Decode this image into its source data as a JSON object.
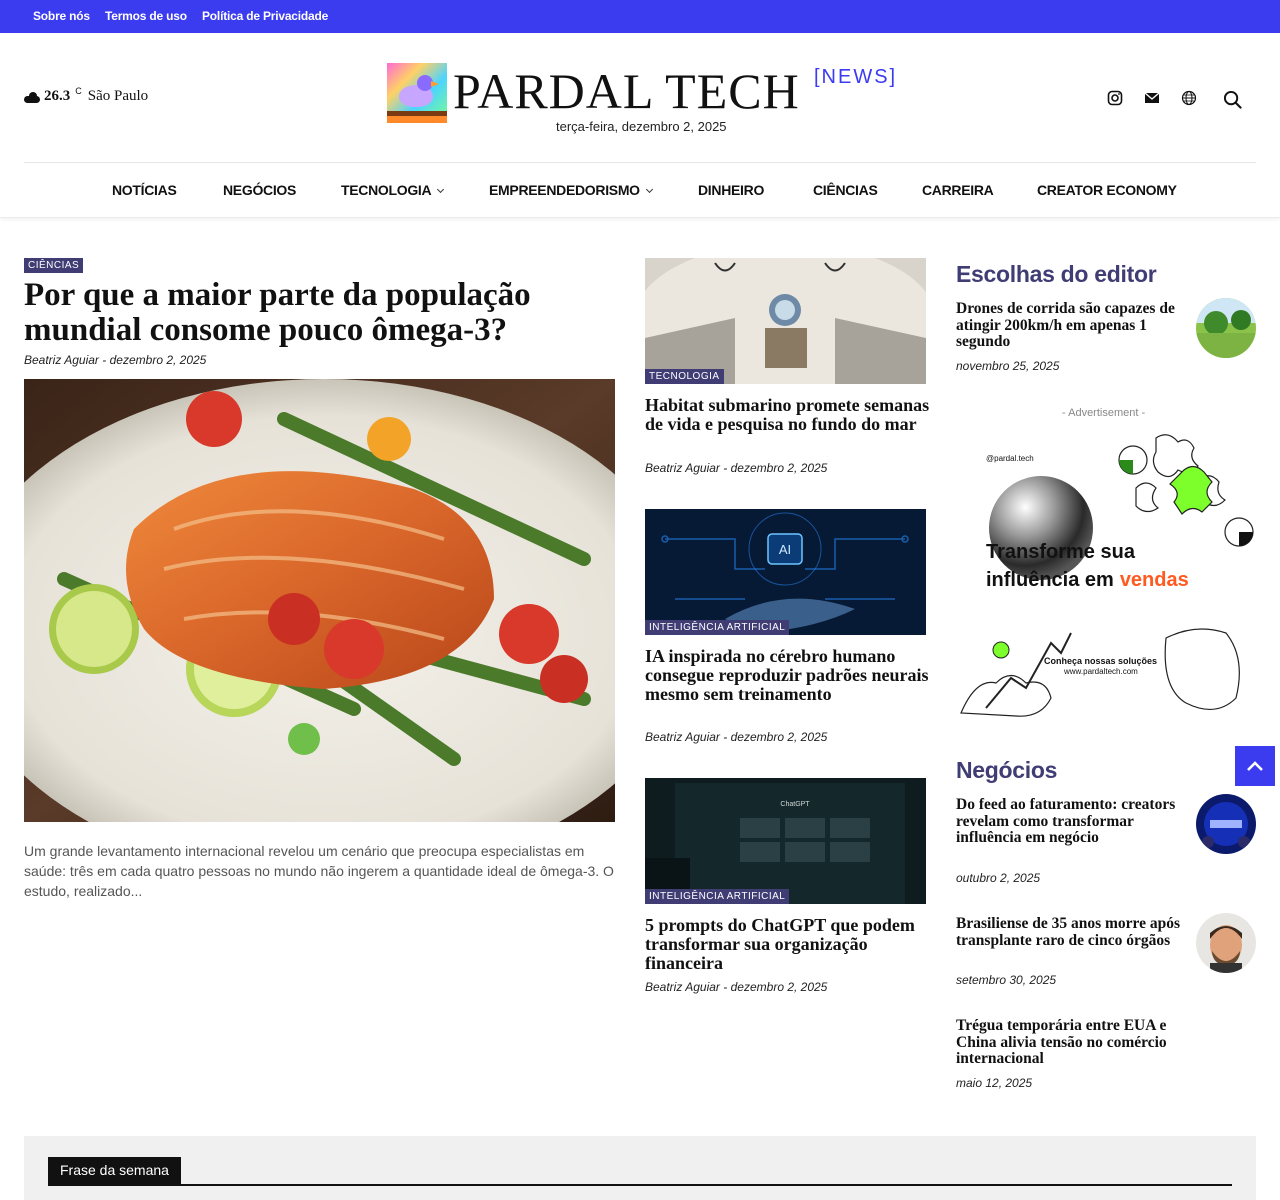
{
  "topbar": {
    "links": [
      "Sobre nós",
      "Termos de uso",
      "Política de Privacidade"
    ],
    "color": "#3b3bf0"
  },
  "header": {
    "weather": {
      "icon": "cloud-icon",
      "temperature": "26.3",
      "unit": "C",
      "city": "São Paulo"
    },
    "logo_title": "PARDAL TECH",
    "logo_tag": "[NEWS]",
    "date": "terça-feira, dezembro 2, 2025",
    "icons": [
      "instagram-icon",
      "mail-icon",
      "globe-icon",
      "search-icon"
    ]
  },
  "nav": {
    "items": [
      "NOTÍCIAS",
      "NEGÓCIOS",
      "TECNOLOGIA",
      "EMPREENDEDORISMO",
      "DINHEIRO",
      "CIÊNCIAS",
      "CARREIRA",
      "CREATOR ECONOMY"
    ]
  },
  "main_article": {
    "category": "CIÊNCIAS",
    "title": "Por que a maior parte da população mundial consome pouco ômega-3?",
    "author": "Beatriz Aguiar",
    "date": "dezembro 2, 2025",
    "excerpt": "Um grande levantamento internacional revelou um cenário que preocupa especialistas em saúde: três em cada quatro pessoas no mundo não ingerem a quantidade ideal de ômega-3. O estudo, realizado..."
  },
  "mid_articles": [
    {
      "category": "TECNOLOGIA",
      "title": "Habitat submarino promete semanas de vida e pesquisa no fundo do mar",
      "author": "Beatriz Aguiar",
      "date": "dezembro 2, 2025"
    },
    {
      "category": "INTELIGÊNCIA ARTIFICIAL",
      "title": "IA inspirada no cérebro humano consegue reproduzir padrões neurais mesmo sem treinamento",
      "author": "Beatriz Aguiar",
      "date": "dezembro 2, 2025"
    },
    {
      "category": "INTELIGÊNCIA ARTIFICIAL",
      "title": "5 prompts do ChatGPT que podem transformar sua organização financeira",
      "author": "Beatriz Aguiar",
      "date": "dezembro 2, 2025"
    }
  ],
  "editor_picks": {
    "title": "Escolhas do editor",
    "items": [
      {
        "title": "Drones de corrida são capazes de atingir 200km/h em apenas 1 segundo",
        "date": "novembro 25, 2025"
      }
    ]
  },
  "ad": {
    "label": "- Advertisement -",
    "handle": "@pardal.tech",
    "headline_1": "Transforme sua",
    "headline_2": "influência em",
    "headline_accent": "vendas",
    "cta": "Conheça nossas soluções",
    "url": "www.pardaltech.com"
  },
  "business": {
    "title": "Negócios",
    "items": [
      {
        "title": "Do feed ao faturamento: creators revelam como transformar influência em negócio",
        "date": "outubro 2, 2025"
      },
      {
        "title": "Brasiliense de 35 anos morre após transplante raro de cinco órgãos",
        "date": "setembro 30, 2025"
      },
      {
        "title": "Trégua temporária entre EUA e China alivia tensão no comércio internacional",
        "date": "maio 12, 2025"
      }
    ]
  },
  "footer_band": {
    "tab": "Frase da semana"
  },
  "colors": {
    "accent": "#3b3bf0",
    "category": "#3f3d74",
    "ad_accent": "#ff5a1f"
  }
}
